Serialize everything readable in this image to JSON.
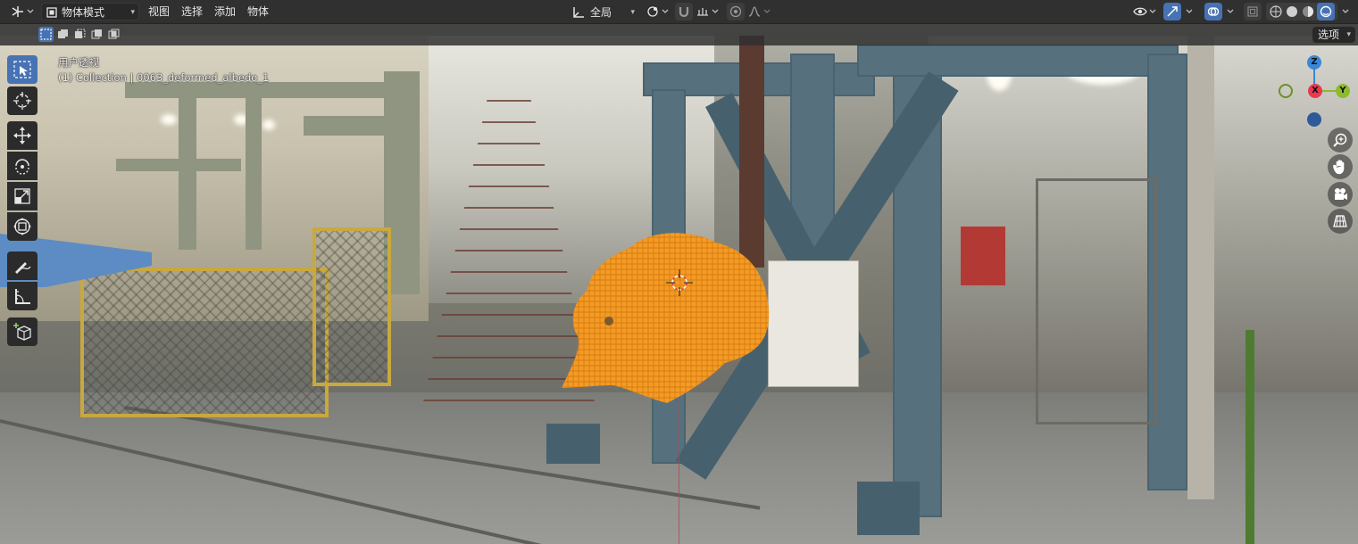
{
  "header": {
    "editor_type_icon": "viewport-editor-icon",
    "mode_label": "物体模式",
    "menus": [
      "视图",
      "选择",
      "添加",
      "物体"
    ],
    "transform_orientation": "全局",
    "options_label": "选项"
  },
  "viewport": {
    "view_name": "用户透视",
    "collection_info": "(1) Collection | 0063_deformed_albedo_1"
  },
  "gizmo": {
    "z_label": "Z",
    "x_label": "X",
    "y_label": "Y",
    "colors": {
      "x": "#e8394f",
      "y": "#8dbb2c",
      "z": "#3b86d8"
    }
  },
  "tools": [
    {
      "name": "select-box-tool",
      "icon": "select-box-icon"
    },
    {
      "name": "cursor-tool",
      "icon": "cursor-icon"
    },
    {
      "name": "move-tool",
      "icon": "move-icon"
    },
    {
      "name": "rotate-tool",
      "icon": "rotate-icon"
    },
    {
      "name": "scale-tool",
      "icon": "scale-icon"
    },
    {
      "name": "transform-tool",
      "icon": "transform-icon"
    },
    {
      "name": "annotate-tool",
      "icon": "annotate-icon"
    },
    {
      "name": "measure-tool",
      "icon": "measure-icon"
    },
    {
      "name": "add-cube-tool",
      "icon": "add-cube-icon"
    }
  ],
  "colors": {
    "accent": "#4772b3",
    "selected_object": "#f59a23",
    "header_bg": "#303030"
  }
}
